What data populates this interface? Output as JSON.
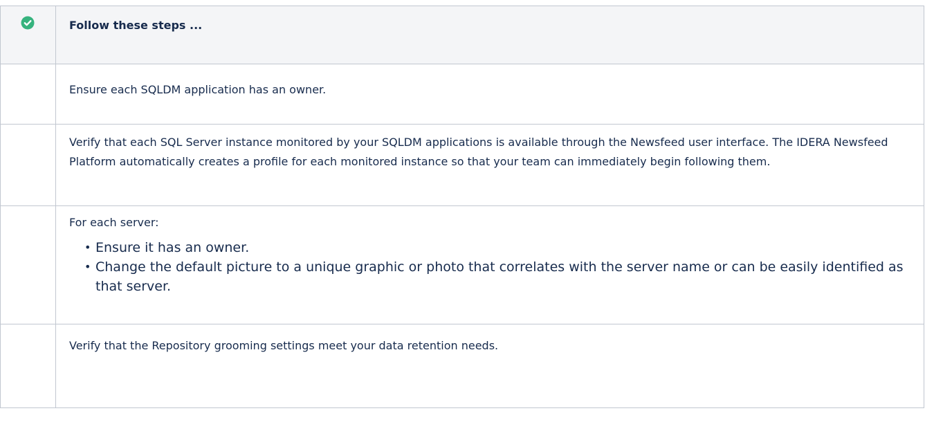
{
  "panel": {
    "icon": "check-circle-icon",
    "icon_color": "#36b37e",
    "header_background": "#f4f5f7",
    "border_color": "#c1c7d0",
    "header": "Follow these steps ..."
  },
  "steps": [
    {
      "text": "Ensure each SQLDM application has an owner."
    },
    {
      "text": "Verify that each SQL Server instance monitored by your SQLDM applications is available through the Newsfeed user interface. The IDERA Newsfeed Platform automatically creates a profile for each monitored instance so that your team can immediately begin following them."
    },
    {
      "text": "For each server:",
      "bullets": [
        "Ensure it has an owner.",
        "Change the default picture to a unique graphic or photo that correlates with the server name or can be easily identified as that server."
      ]
    },
    {
      "text": "Verify that the Repository grooming settings meet your data retention needs."
    }
  ]
}
